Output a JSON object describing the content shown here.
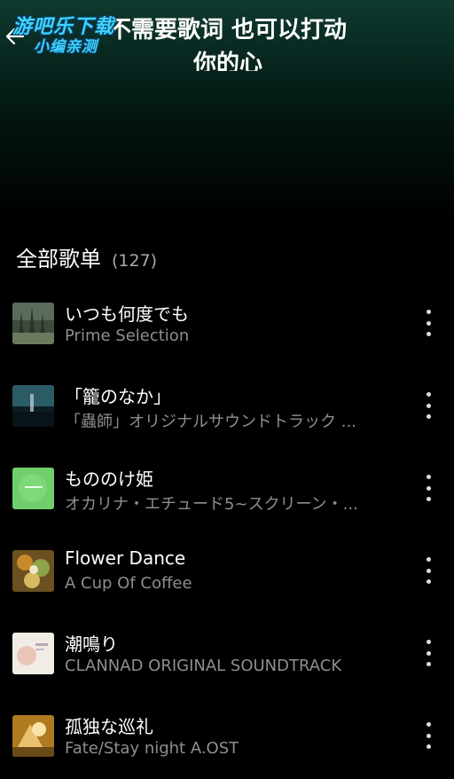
{
  "header": {
    "title_line1": "不需要歌词 也可以打动",
    "title_line2": "你的心",
    "watermark_line1": "游吧乐下载",
    "watermark_line2": "小编亲测"
  },
  "section": {
    "title": "全部歌单",
    "count": "(127)"
  },
  "songs": [
    {
      "title": "いつも何度でも",
      "subtitle": "Prime Selection",
      "cover_color": "#4a5a4a"
    },
    {
      "title": "「籠のなか」",
      "subtitle": "「蟲師」オリジナルサウンドトラック ...",
      "cover_color": "#1c3a44"
    },
    {
      "title": "もののけ姫",
      "subtitle": "オカリナ・エチュード5~スクリーン・...",
      "cover_color": "#6fcf6a"
    },
    {
      "title": "Flower Dance",
      "subtitle": "A Cup Of Coffee",
      "cover_color": "#8a6a30"
    },
    {
      "title": "潮鳴り",
      "subtitle": "CLANNAD ORIGINAL SOUNDTRACK",
      "cover_color": "#e8e0d8"
    },
    {
      "title": "孤独な巡礼",
      "subtitle": "Fate/Stay night A.OST",
      "cover_color": "#c8902a"
    }
  ],
  "colors": {
    "header_gradient_top": "#0f3a30",
    "background": "#000000",
    "subtitle": "#8e8e8e",
    "watermark": "#3fd3ff"
  }
}
